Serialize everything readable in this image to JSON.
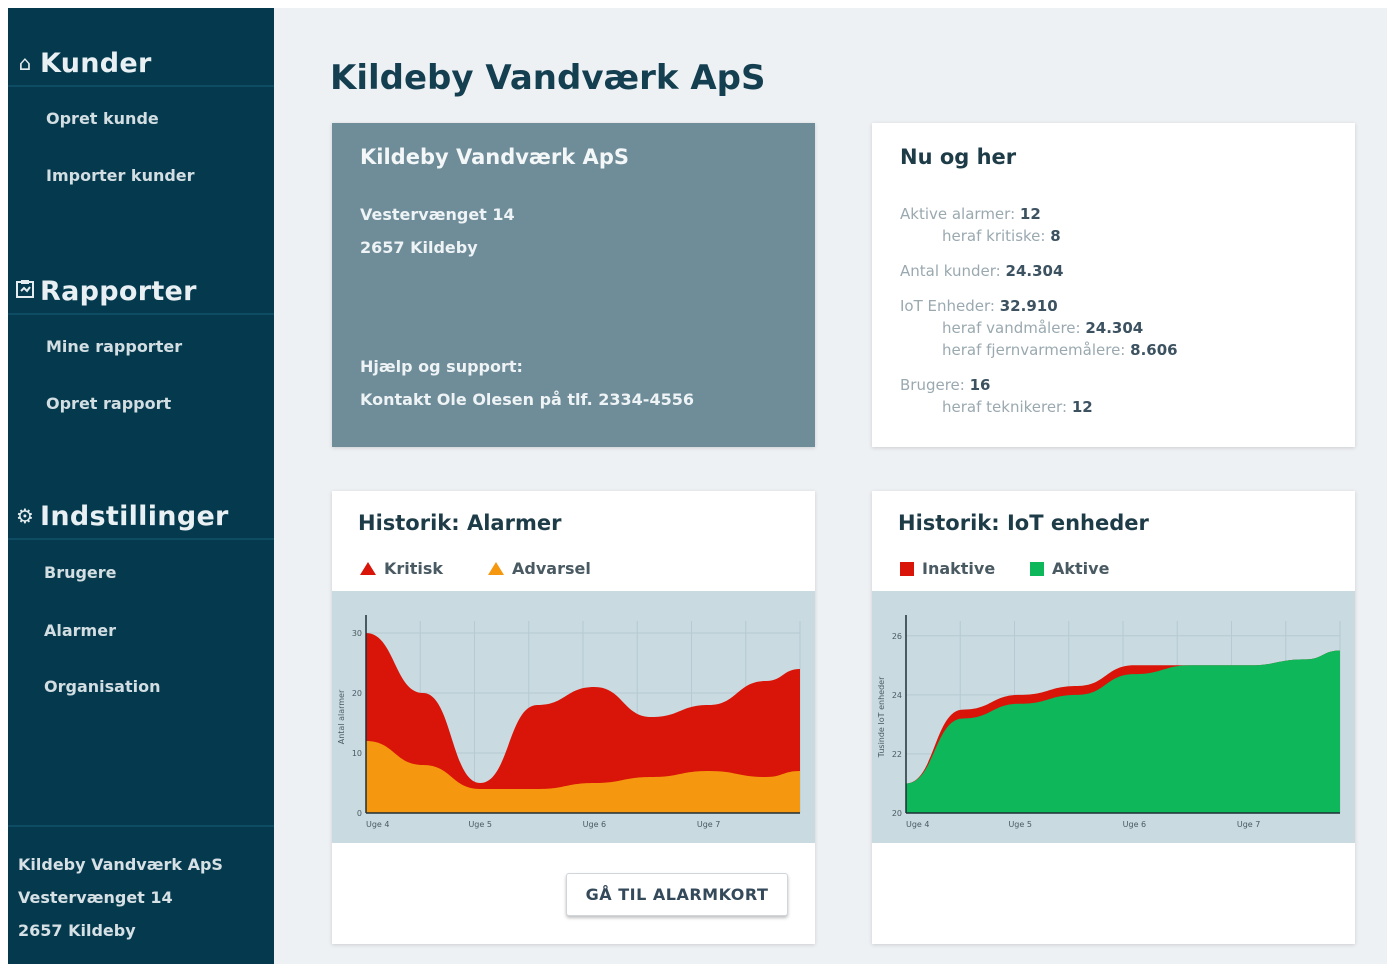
{
  "sidebar": {
    "sections": [
      {
        "icon": "home-icon",
        "label": "Kunder",
        "items": [
          "Opret kunde",
          "Importer kunder"
        ]
      },
      {
        "icon": "report-icon",
        "label": "Rapporter",
        "items": [
          "Mine rapporter",
          "Opret rapport"
        ]
      },
      {
        "icon": "gear-icon",
        "label": "Indstillinger",
        "items": [
          "Brugere",
          "Alarmer",
          "Organisation"
        ]
      }
    ],
    "footer": {
      "company": "Kildeby Vandværk ApS",
      "street": "Vestervænget 14",
      "city": "2657 Kildeby"
    }
  },
  "page": {
    "title": "Kildeby Vandværk ApS"
  },
  "info_card": {
    "title": "Kildeby Vandværk ApS",
    "street": "Vestervænget 14",
    "city": "2657 Kildeby",
    "support_label": "Hjælp og support:",
    "support_contact": "Kontakt Ole Olesen på tlf. 2334-4556"
  },
  "stats_card": {
    "title": "Nu og her",
    "active_alarms": {
      "label": "Aktive alarmer:",
      "value": "12"
    },
    "critical": {
      "label": "heraf kritiske:",
      "value": "8"
    },
    "customers": {
      "label": "Antal kunder:",
      "value": "24.304"
    },
    "iot": {
      "label": "IoT Enheder:",
      "value": "32.910"
    },
    "water_meters": {
      "label": "heraf vandmålere:",
      "value": "24.304"
    },
    "heat_meters": {
      "label": "heraf fjernvarmemålere:",
      "value": "8.606"
    },
    "users": {
      "label": "Brugere:",
      "value": "16"
    },
    "technicians": {
      "label": "heraf teknikerer:",
      "value": "12"
    }
  },
  "alarm_chart_card": {
    "title": "Historik: Alarmer",
    "legend": [
      "Kritisk",
      "Advarsel"
    ],
    "button_label": "GÅ TIL ALARMKORT"
  },
  "iot_chart_card": {
    "title": "Historik: IoT enheder",
    "legend": [
      "Inaktive",
      "Aktive"
    ]
  },
  "colors": {
    "critical": "#d91408",
    "warning": "#f5980f",
    "inactive": "#d91408",
    "active": "#0db75a",
    "sidebar": "#053a4e"
  },
  "chart_data": [
    {
      "type": "area",
      "ylabel": "Antal alarmer",
      "x_ticks": [
        "Uge 4",
        "Uge 5",
        "Uge 6",
        "Uge 7"
      ],
      "y_ticks": [
        0,
        10,
        20,
        30
      ],
      "ylim": [
        0,
        32
      ],
      "x": [
        0,
        0.5,
        1,
        1.5,
        2,
        2.5,
        3,
        3.5,
        3.8
      ],
      "series": [
        {
          "name": "Kritisk",
          "values": [
            30,
            20,
            5,
            18,
            21,
            16,
            18,
            22,
            24
          ]
        },
        {
          "name": "Advarsel",
          "values": [
            12,
            8,
            4,
            4,
            5,
            6,
            7,
            6,
            7
          ]
        }
      ],
      "grid": true
    },
    {
      "type": "area",
      "ylabel": "Tusinde IoT enheder",
      "x_ticks": [
        "Uge 4",
        "Uge 5",
        "Uge 6",
        "Uge 7"
      ],
      "y_ticks": [
        20,
        22,
        24,
        26
      ],
      "ylim": [
        20,
        26.5
      ],
      "x": [
        0,
        0.5,
        1,
        1.5,
        2,
        2.5,
        3,
        3.5,
        3.8
      ],
      "series": [
        {
          "name": "Inaktive",
          "values": [
            21,
            23.5,
            24,
            24.3,
            25,
            25,
            25,
            25.2,
            25.5
          ]
        },
        {
          "name": "Aktive",
          "values": [
            21,
            23.2,
            23.7,
            24,
            24.7,
            25,
            25,
            25.2,
            25.5
          ]
        }
      ],
      "grid": true
    }
  ]
}
